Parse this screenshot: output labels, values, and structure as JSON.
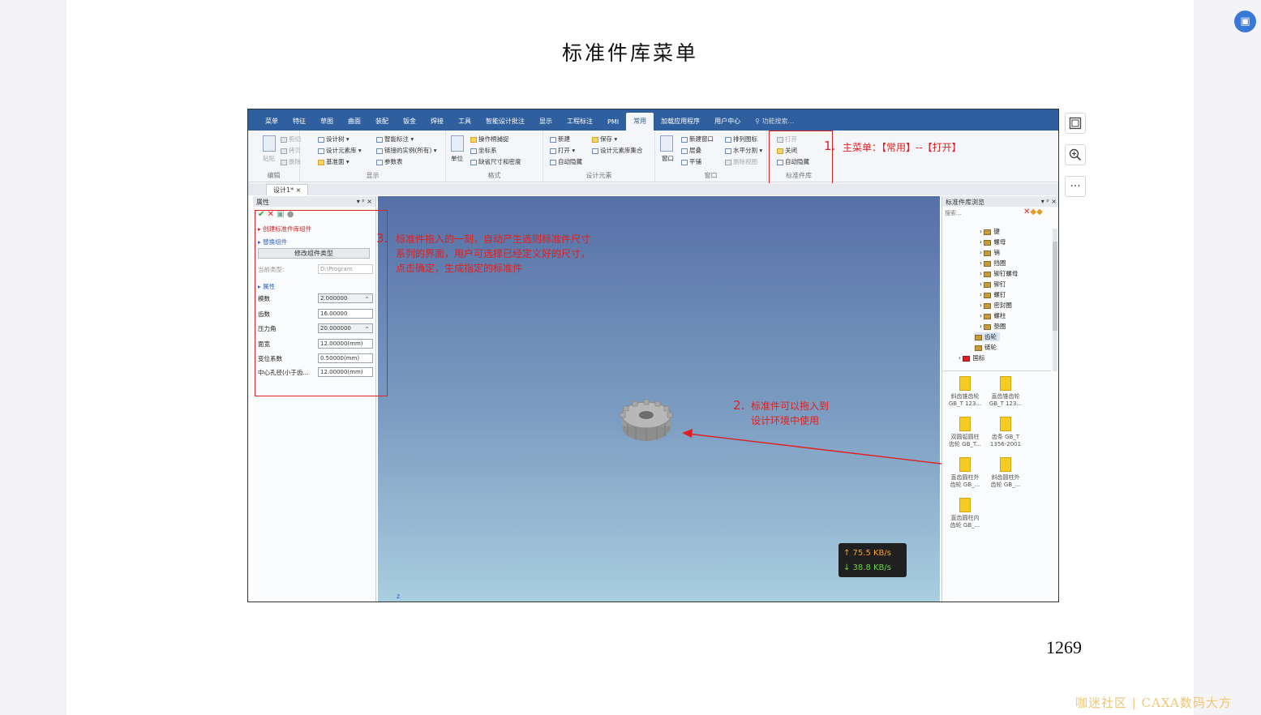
{
  "document": {
    "title": "标准件库菜单",
    "page_number": "1269"
  },
  "app": {
    "ribbon_tabs": [
      "菜单",
      "特征",
      "草图",
      "曲面",
      "装配",
      "钣金",
      "焊接",
      "工具",
      "智能设计批注",
      "显示",
      "工程标注",
      "PMI",
      "常用",
      "加载应用程序",
      "用户中心",
      "功能搜索..."
    ],
    "active_tab": "常用",
    "groups": {
      "edit": {
        "label": "编辑",
        "items": [
          "剪切",
          "拷贝",
          "删除"
        ],
        "big": "粘贴"
      },
      "display": {
        "label": "显示",
        "items": [
          "设计树",
          "设计元素库",
          "基准面",
          "智能标注",
          "链接的实例(所有)",
          "参数表"
        ]
      },
      "format": {
        "label": "格式",
        "items": [
          "操作柄捕捉",
          "坐标系",
          "缺省尺寸和密度"
        ],
        "big": "单位"
      },
      "design_elements": {
        "label": "设计元素",
        "items": [
          "新建",
          "打开",
          "自动隐藏",
          "保存",
          "设计元素库集合"
        ]
      },
      "window": {
        "label": "窗口",
        "items": [
          "新建窗口",
          "层叠",
          "平铺",
          "排列图标",
          "水平分割",
          "删除视图"
        ],
        "big": "窗口"
      },
      "std_lib": {
        "label": "标准件库",
        "items": [
          "打开",
          "关闭",
          "自动隐藏"
        ]
      }
    },
    "doc_tab": "设计1*",
    "left_panel": {
      "header": "属性",
      "create_link": "创建标准件库组件",
      "replace_link": "替换组件",
      "modify_button": "修改组件类型",
      "current_type_label": "当前类型:",
      "current_type_value": "D:\\Program",
      "section": "属性",
      "props": [
        {
          "label": "模数",
          "value": "2.000000"
        },
        {
          "label": "齿数",
          "value": "16.00000"
        },
        {
          "label": "压力角",
          "value": "20.000000"
        },
        {
          "label": "面宽",
          "value": "12.00000(mm)"
        },
        {
          "label": "变位系数",
          "value": "0.50000(mm)"
        },
        {
          "label": "中心孔径(小于齿...",
          "value": "12.00000(mm)"
        }
      ]
    },
    "right_panel": {
      "header": "标准件库浏览",
      "search_placeholder": "搜索...",
      "tree": [
        "键",
        "螺母",
        "销",
        "挡圈",
        "铆钉螺母",
        "铆钉",
        "螺钉",
        "密封圈",
        "螺柱",
        "垫圈",
        "齿轮",
        "链轮",
        "国标"
      ],
      "files": [
        {
          "line1": "斜齿锥齿轮",
          "line2": "GB_T 123..."
        },
        {
          "line1": "直齿锥齿轮",
          "line2": "GB_T 123..."
        },
        {
          "line1": "双圆弧圆柱",
          "line2": "齿轮 GB_T..."
        },
        {
          "line1": "齿条 GB_T",
          "line2": "1356-2001"
        },
        {
          "line1": "直齿圆柱外",
          "line2": "齿轮 GB_..."
        },
        {
          "line1": "斜齿圆柱外",
          "line2": "齿轮 GB_..."
        },
        {
          "line1": "直齿圆柱内",
          "line2": "齿轮 GB_..."
        }
      ]
    },
    "speed": {
      "up": "↑ 75.5 KB/s",
      "down": "↓ 38.8 KB/s"
    },
    "axis_label": "z"
  },
  "annotations": {
    "a1_num": "1.",
    "a1_text": "主菜单：【常用】--【打开】",
    "a2_num": "2.",
    "a2_line1": "标准件可以拖入到",
    "a2_line2": "设计环境中使用",
    "a3_num": "3.",
    "a3_line1": "标准件拖入的一刻，自动产生选则标准件尺寸",
    "a3_line2": "系列的界面，用户可选择已经定义好的尺寸，",
    "a3_line3": "点击确定，生成指定的标准件"
  },
  "viewer": {
    "tools": [
      "image-icon",
      "zoom-icon",
      "more-icon"
    ],
    "more_label": "···"
  },
  "watermark": "咖迷社区 | CAXA数码大方",
  "colors": {
    "ribbon": "#2f5f9e",
    "annotation": "#e02020"
  }
}
